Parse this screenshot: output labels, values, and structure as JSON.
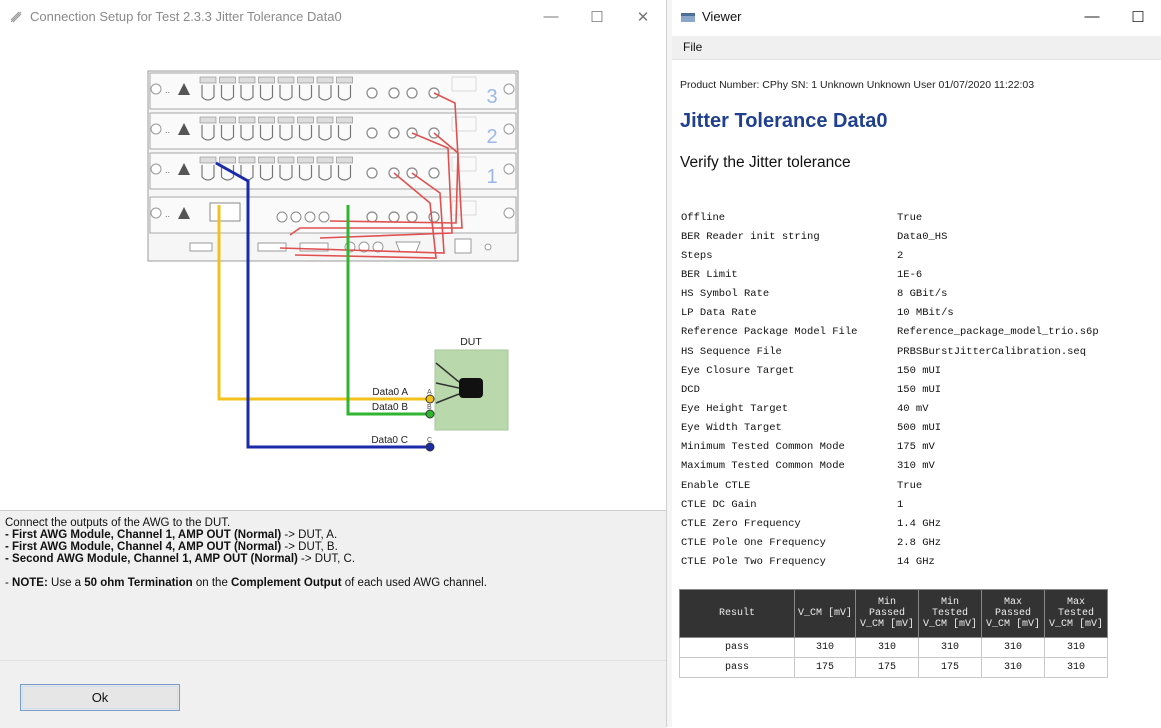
{
  "left_window": {
    "title": "Connection Setup for Test 2.3.3 Jitter Tolerance Data0",
    "controls": {
      "minimize": "—",
      "maximize": "☐",
      "close": "✕"
    },
    "diagram": {
      "module_numbers": [
        "3",
        "2",
        "1"
      ],
      "dut_label": "DUT",
      "signals": [
        {
          "label": "Data0 A",
          "pin": "A",
          "color": "#f2c21a"
        },
        {
          "label": "Data0 B",
          "pin": "B",
          "color": "#2fb52f"
        },
        {
          "label": "Data0 C",
          "pin": "C",
          "color": "#1a2aa8"
        }
      ],
      "cable_red": "#e05050"
    },
    "instructions": {
      "intro": "Connect the outputs of the AWG to the DUT.",
      "items": [
        {
          "bold": "- First AWG Module, Channel 1, AMP OUT (Normal)",
          "rest": " -> DUT, A."
        },
        {
          "bold": "- First AWG Module, Channel 4, AMP OUT (Normal)",
          "rest": " -> DUT, B."
        },
        {
          "bold": "- Second AWG Module, Channel 1, AMP OUT (Normal)",
          "rest": " -> DUT, C."
        }
      ],
      "note_prefix": "- ",
      "note_label": "NOTE:",
      "note_text1": " Use a ",
      "note_bold1": "50 ohm Termination",
      "note_text2": " on the ",
      "note_bold2": "Complement Output",
      "note_text3": " of each used AWG channel."
    },
    "ok_label": "Ok"
  },
  "right_window": {
    "title": "Viewer",
    "controls": {
      "minimize": "—",
      "maximize": "☐"
    },
    "menu_file": "File",
    "product_line": "Product Number: CPhy SN: 1 Unknown Unknown User 01/07/2020 11:22:03",
    "report_title": "Jitter Tolerance Data0",
    "report_subtitle": "Verify the Jitter tolerance",
    "params": [
      {
        "key": "Offline",
        "value": "True"
      },
      {
        "key": "BER Reader init string",
        "value": "Data0_HS"
      },
      {
        "key": "Steps",
        "value": "2"
      },
      {
        "key": "BER Limit",
        "value": "1E-6"
      },
      {
        "key": "HS Symbol Rate",
        "value": "8 GBit/s"
      },
      {
        "key": "LP Data Rate",
        "value": "10 MBit/s"
      },
      {
        "key": "Reference Package Model File",
        "value": "Reference_package_model_trio.s6p"
      },
      {
        "key": "HS Sequence File",
        "value": "PRBSBurstJitterCalibration.seq"
      },
      {
        "key": "Eye Closure Target",
        "value": "150 mUI"
      },
      {
        "key": "DCD",
        "value": "150 mUI"
      },
      {
        "key": "Eye Height Target",
        "value": "40 mV"
      },
      {
        "key": "Eye Width Target",
        "value": "500 mUI"
      },
      {
        "key": "Minimum Tested Common Mode",
        "value": "175 mV"
      },
      {
        "key": "Maximum Tested Common Mode",
        "value": "310 mV"
      },
      {
        "key": "Enable CTLE",
        "value": "True"
      },
      {
        "key": "CTLE DC Gain",
        "value": "1"
      },
      {
        "key": "CTLE Zero Frequency",
        "value": "1.4 GHz"
      },
      {
        "key": "CTLE Pole One Frequency",
        "value": "2.8 GHz"
      },
      {
        "key": "CTLE Pole Two Frequency",
        "value": "14 GHz"
      }
    ],
    "results": {
      "headers": [
        [
          "Result"
        ],
        [
          "V_CM [mV]"
        ],
        [
          "Min",
          "Passed",
          "V_CM [mV]"
        ],
        [
          "Min",
          "Tested",
          "V_CM [mV]"
        ],
        [
          "Max",
          "Passed",
          "V_CM [mV]"
        ],
        [
          "Max",
          "Tested",
          "V_CM [mV]"
        ]
      ],
      "rows": [
        [
          "pass",
          "310",
          "310",
          "310",
          "310",
          "310"
        ],
        [
          "pass",
          "175",
          "175",
          "175",
          "310",
          "310"
        ]
      ]
    }
  }
}
